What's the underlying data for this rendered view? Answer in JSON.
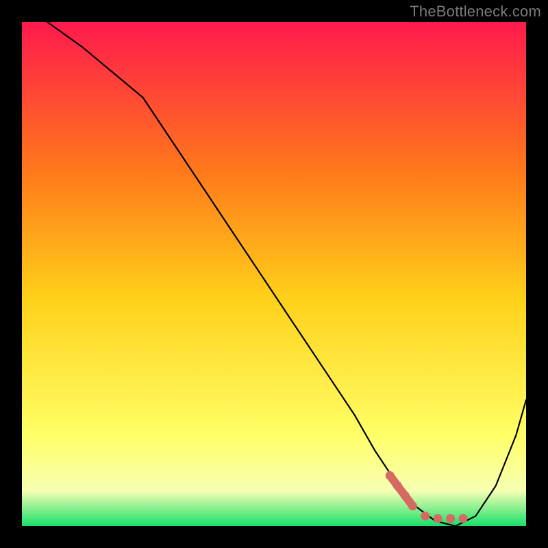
{
  "watermark": "TheBottleneck.com",
  "chart_data": {
    "type": "line",
    "title": "",
    "xlabel": "",
    "ylabel": "",
    "xlim": [
      0,
      100
    ],
    "ylim": [
      0,
      100
    ],
    "grid": false,
    "legend": false,
    "background_gradient": {
      "top": "#ff1a4d",
      "upper_mid": "#ff7a1a",
      "mid": "#ffd11a",
      "lower_mid": "#ffff66",
      "band": "#f7ffb3",
      "bottom": "#18e06b"
    },
    "series": [
      {
        "name": "bottleneck-curve",
        "color": "#000000",
        "x": [
          5,
          12,
          18,
          24,
          30,
          36,
          42,
          48,
          54,
          60,
          66,
          70,
          74,
          78,
          82,
          86,
          90,
          94,
          98,
          100
        ],
        "y": [
          100,
          95,
          90,
          85,
          76,
          67,
          58,
          49,
          40,
          31,
          22,
          15,
          9,
          4,
          1,
          0,
          2,
          8,
          18,
          25
        ]
      },
      {
        "name": "highlight-dots",
        "color": "#d66a63",
        "type": "scatter",
        "x": [
          73,
          74.5,
          76,
          77.5,
          80,
          82.5,
          85,
          87.5
        ],
        "y": [
          10,
          8,
          6,
          4,
          2,
          1.5,
          1.5,
          1.5
        ]
      }
    ]
  }
}
